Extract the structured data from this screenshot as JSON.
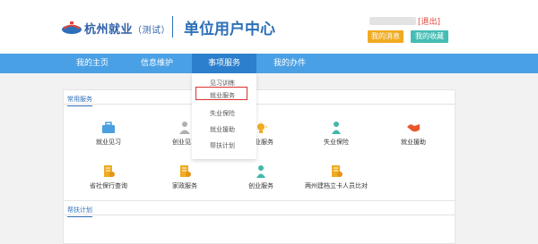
{
  "header": {
    "logo_text": "杭州就业",
    "logo_sub": "（测试）",
    "center_title": "单位用户中心",
    "logout_label": "[退出]",
    "my_messages_label": "我的消息",
    "my_favorites_label": "我的收藏"
  },
  "nav": {
    "items": [
      {
        "label": "我的主页"
      },
      {
        "label": "信息维护"
      },
      {
        "label": "事项服务"
      },
      {
        "label": "我的办件"
      }
    ],
    "active": "事项服务"
  },
  "dropdown": {
    "items": [
      "见习训练",
      "就业服务",
      "失业保险",
      "就业援助",
      "帮扶计划"
    ],
    "highlighted": "就业服务"
  },
  "common_services": {
    "title": "常用服务",
    "items": [
      {
        "label": "就业见习",
        "icon": "briefcase-icon",
        "color": "#4a9fe0"
      },
      {
        "label": "创业见习",
        "icon": "person-icon",
        "color": "#b0b0b0"
      },
      {
        "label": "就业服务",
        "icon": "bulb-icon",
        "color": "#f0ab21"
      },
      {
        "label": "失业保险",
        "icon": "person-icon",
        "color": "#40b8a8"
      },
      {
        "label": "就业援助",
        "icon": "handshake-icon",
        "color": "#e8572c"
      },
      {
        "label": "省社保行查询",
        "icon": "document-icon",
        "color": "#f0ab21"
      },
      {
        "label": "家政服务",
        "icon": "document-icon",
        "color": "#f0ab21"
      },
      {
        "label": "创业服务",
        "icon": "person-icon",
        "color": "#40b8a8"
      },
      {
        "label": "两州建档立卡人员比对",
        "icon": "document-icon",
        "color": "#f0ab21"
      }
    ]
  },
  "plan_panel": {
    "title": "帮扶计划"
  }
}
